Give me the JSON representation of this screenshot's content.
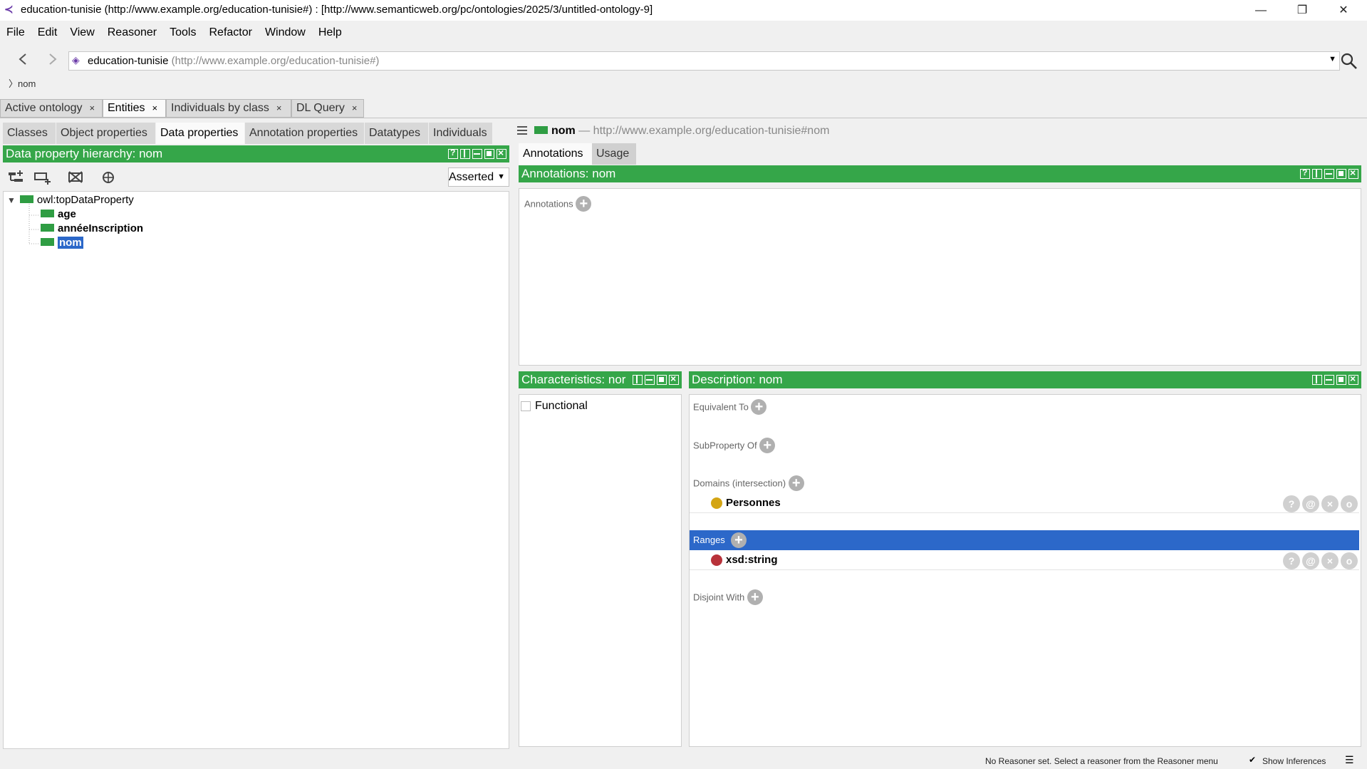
{
  "window": {
    "title": "education-tunisie (http://www.example.org/education-tunisie#)  : [http://www.semanticweb.org/pc/ontologies/2025/3/untitled-ontology-9]",
    "minimize": "—",
    "maximize": "❐",
    "close": "✕"
  },
  "menu": [
    "File",
    "Edit",
    "View",
    "Reasoner",
    "Tools",
    "Refactor",
    "Window",
    "Help"
  ],
  "nav": {
    "back": "‹",
    "forward": "›",
    "ontology_name": "education-tunisie",
    "ontology_iri": "(http://www.example.org/education-tunisie#)",
    "breadcrumb": "nom"
  },
  "main_tabs": [
    {
      "label": "Active ontology",
      "close": "×"
    },
    {
      "label": "Entities",
      "close": "×"
    },
    {
      "label": "Individuals by class",
      "close": "×"
    },
    {
      "label": "DL Query",
      "close": "×"
    }
  ],
  "sub_tabs": [
    "Classes",
    "Object properties",
    "Data properties",
    "Annotation properties",
    "Datatypes",
    "Individuals"
  ],
  "hierarchy": {
    "header": "Data property hierarchy: nom",
    "mode": "Asserted",
    "root": "owl:topDataProperty",
    "children": [
      "age",
      "annéeInscription",
      "nom"
    ]
  },
  "entity": {
    "name": "nom",
    "iri": "— http://www.example.org/education-tunisie#nom"
  },
  "detail_tabs": [
    "Annotations",
    "Usage"
  ],
  "annotations": {
    "header": "Annotations: nom",
    "label": "Annotations"
  },
  "characteristics": {
    "header": "Characteristics: nor",
    "functional": "Functional"
  },
  "description": {
    "header": "Description: nom",
    "equivalent_to": "Equivalent To",
    "subproperty_of": "SubProperty Of",
    "domains": "Domains (intersection)",
    "domain_item": "Personnes",
    "ranges": "Ranges",
    "range_item": "xsd:string",
    "disjoint_with": "Disjoint With"
  },
  "row_buttons": [
    "?",
    "@",
    "×",
    "o"
  ],
  "status": {
    "message": "No Reasoner set. Select a reasoner from the Reasoner menu",
    "show_inferences": "Show Inferences",
    "show_inferences_checked": true
  },
  "colors": {
    "header_green": "#35a649",
    "selection_blue": "#2c68c9",
    "domain_dot": "#d4a514",
    "range_dot": "#b8323a"
  }
}
